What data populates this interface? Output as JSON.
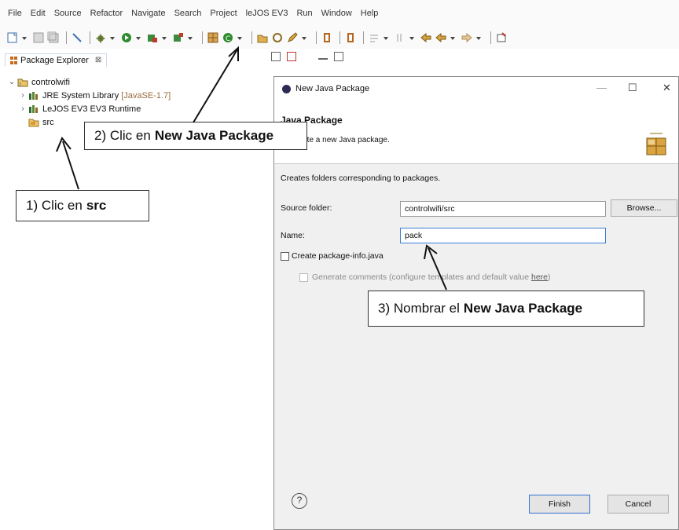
{
  "menu": [
    "File",
    "Edit",
    "Source",
    "Refactor",
    "Navigate",
    "Search",
    "Project",
    "leJOS EV3",
    "Run",
    "Window",
    "Help"
  ],
  "explorer": {
    "tab_label": "Package Explorer",
    "tab_close": "⊠",
    "tree": {
      "project": "controlwifi",
      "jre_label": "JRE System Library",
      "jre_version": "[JavaSE-1.7]",
      "lejos_label": "LeJOS EV3 EV3 Runtime",
      "src_label": "src"
    }
  },
  "dialog": {
    "window_title": "New Java Package",
    "minimize": "—",
    "maximize": "☐",
    "close": "✕",
    "heading": "Java Package",
    "description": "Create a new Java package.",
    "intro": "Creates folders corresponding to packages.",
    "source_folder_label": "Source folder:",
    "source_folder_value": "controlwifi/src",
    "browse_label": "Browse...",
    "name_label": "Name:",
    "name_value": "pack",
    "create_info_label": "Create package-info.java",
    "generate_comments_prefix": "Generate comments (configure templates and default value ",
    "generate_comments_link": "here",
    "generate_comments_suffix": ")",
    "help_symbol": "?",
    "finish_label": "Finish",
    "cancel_label": "Cancel"
  },
  "annotations": {
    "step1_prefix": "1)  Clic en",
    "step1_bold": "src",
    "step2_prefix": "2)  Clic en",
    "step2_bold": "New Java Package",
    "step3_prefix": "3)  Nombrar el",
    "step3_bold": "New Java Package"
  },
  "colors": {
    "accent_blue": "#3b7bd6",
    "jre_version": "#9a6a3a"
  }
}
